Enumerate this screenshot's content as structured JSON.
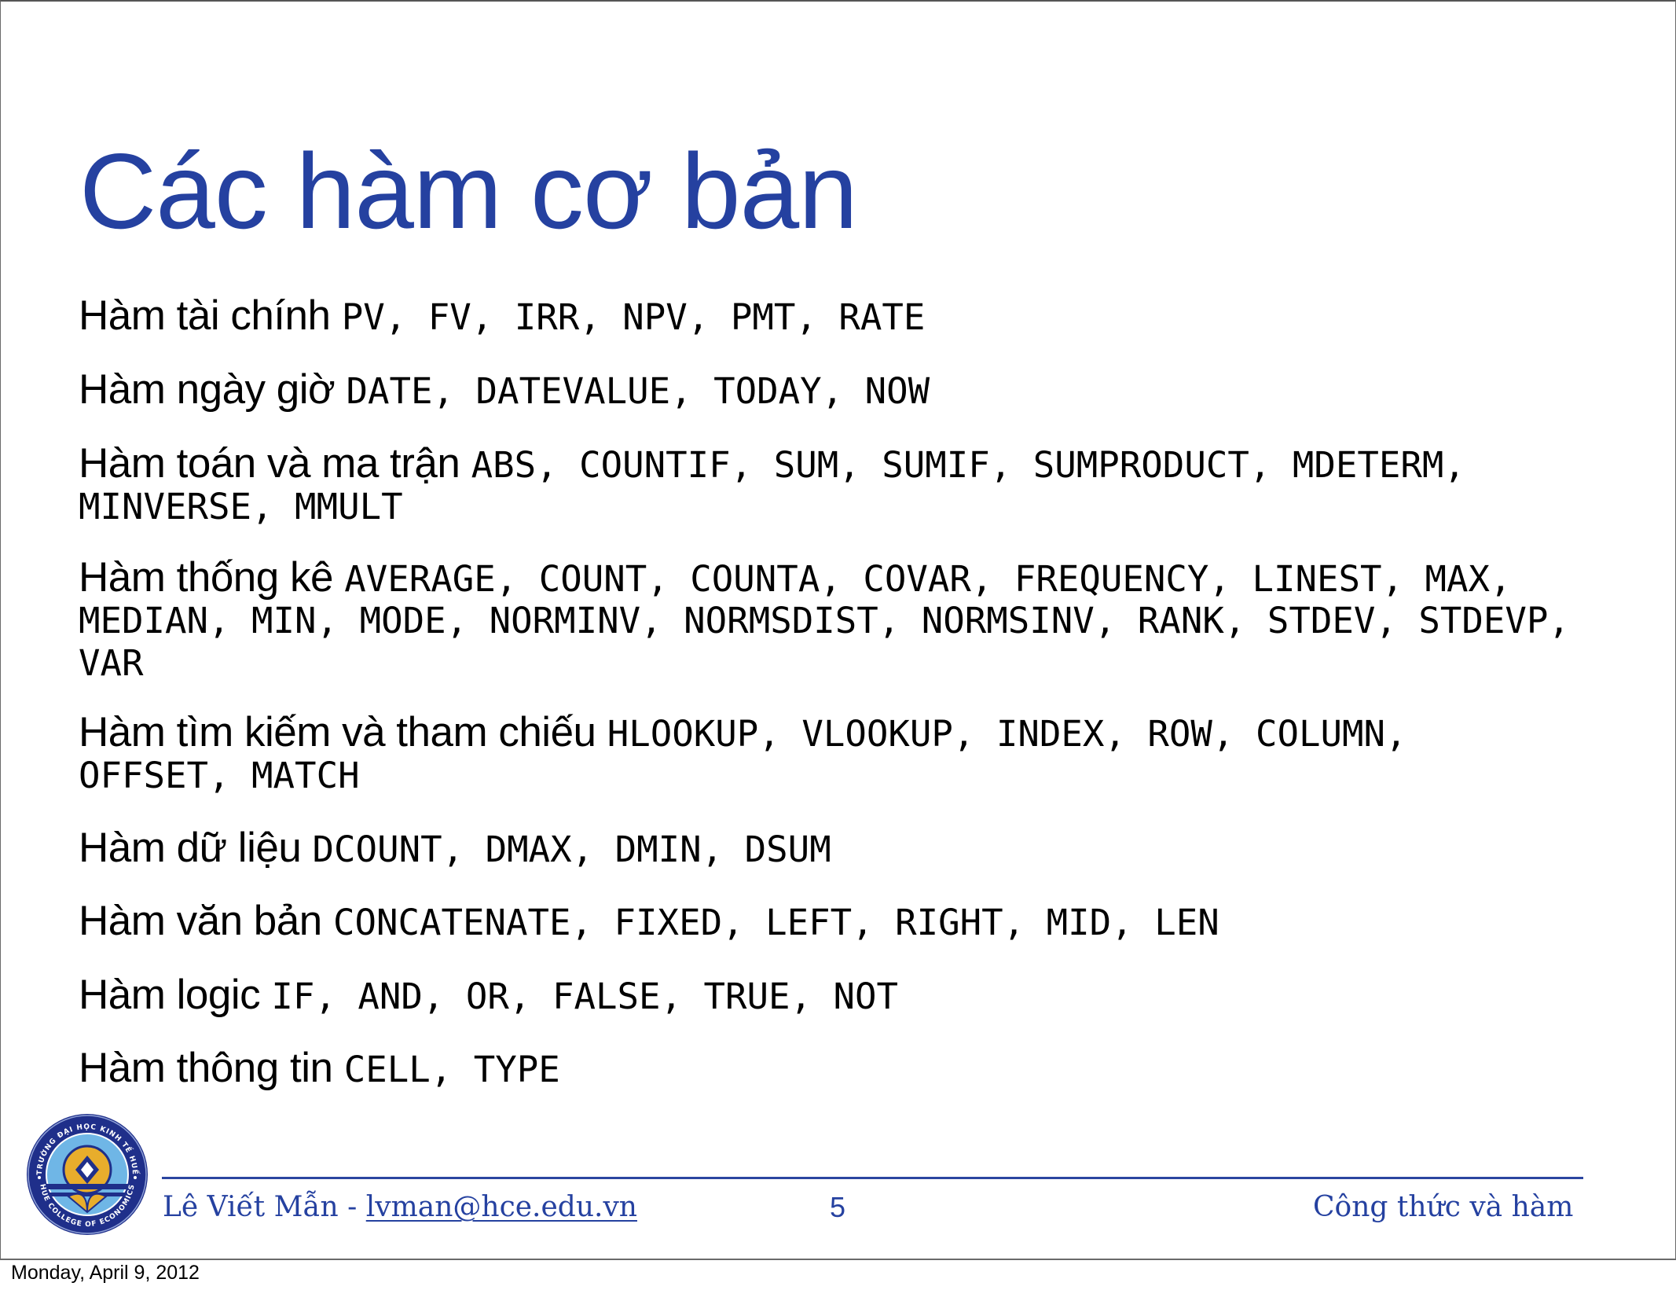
{
  "slide": {
    "title": "Các hàm cơ bản",
    "items": [
      {
        "label": "Hàm tài chính ",
        "lines": [
          "PV, FV, IRR, NPV, PMT, RATE"
        ]
      },
      {
        "label": "Hàm ngày giờ ",
        "lines": [
          "DATE, DATEVALUE, TODAY, NOW"
        ]
      },
      {
        "label": "Hàm toán và ma trận ",
        "lines": [
          "ABS, COUNTIF, SUM, SUMIF, SUMPRODUCT, MDETERM,",
          "MINVERSE, MMULT"
        ]
      },
      {
        "label": "Hàm thống kê ",
        "lines": [
          "AVERAGE, COUNT, COUNTA, COVAR, FREQUENCY, LINEST, MAX,",
          "MEDIAN, MIN, MODE, NORMINV, NORMSDIST, NORMSINV, RANK, STDEV, STDEVP,",
          "VAR"
        ]
      },
      {
        "label": "Hàm tìm kiếm và tham chiếu ",
        "lines": [
          "HLOOKUP, VLOOKUP, INDEX, ROW, COLUMN,",
          "OFFSET, MATCH"
        ]
      },
      {
        "label": "Hàm dữ liệu ",
        "lines": [
          "DCOUNT, DMAX, DMIN, DSUM"
        ]
      },
      {
        "label": "Hàm văn bản ",
        "lines": [
          "CONCATENATE, FIXED, LEFT, RIGHT, MID, LEN"
        ]
      },
      {
        "label": "Hàm logic ",
        "lines": [
          "IF, AND, OR, FALSE, TRUE, NOT"
        ]
      },
      {
        "label": "Hàm thông tin ",
        "lines": [
          "CELL, TYPE"
        ]
      }
    ]
  },
  "footer": {
    "author": "Lê Viết Mẫn - ",
    "email": "lvman@hce.edu.vn",
    "page_number": "5",
    "section": "Công thức và hàm",
    "logo": {
      "icon": "university-seal-icon",
      "top_text": "TRƯỜNG ĐẠI HỌC KINH TẾ HUẾ",
      "bottom_text": "HUE COLLEGE OF ECONOMICS"
    }
  },
  "print_date": "Monday, April 9, 2012",
  "colors": {
    "title": "#2541a0",
    "footer": "#2541a0",
    "logo_navy": "#1f2f8a",
    "logo_light_blue": "#6fb6e6",
    "logo_gold": "#e8ad2c"
  }
}
